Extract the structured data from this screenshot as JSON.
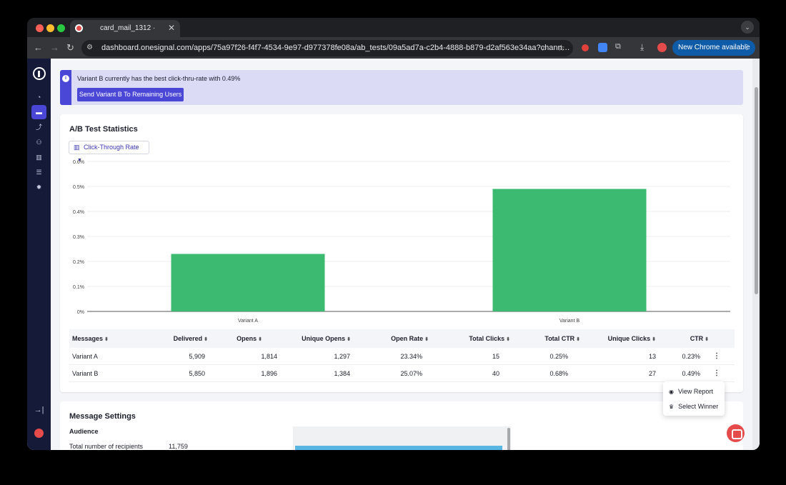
{
  "browser": {
    "tab_title": "card_mail_1312 ·",
    "tab_close": "✕",
    "url": "dashboard.onesignal.com/apps/75a97f26-f4f7-4534-9e97-d977378fe08a/ab_tests/09a5ad7a-c2b4-4888-b879-d2af563e34aa?chann…",
    "new_chrome_label": "New Chrome available",
    "colors": {
      "traffic_red": "#ff5f57",
      "traffic_yellow": "#febc2e",
      "traffic_green": "#28c840"
    }
  },
  "banner": {
    "text": "Variant B currently has the best click-thru-rate with 0.49%",
    "button_label": "Send Variant B To Remaining Users"
  },
  "stats": {
    "title": "A/B Test Statistics",
    "metric_select": "Click-Through Rate"
  },
  "chart_data": {
    "type": "bar",
    "categories": [
      "Variant A",
      "Variant B"
    ],
    "values": [
      0.23,
      0.49
    ],
    "ylim": [
      0,
      0.6
    ],
    "yticks": [
      "0%",
      "0.1%",
      "0.2%",
      "0.3%",
      "0.4%",
      "0.5%",
      "0.6%"
    ],
    "ytick_values": [
      0,
      0.1,
      0.2,
      0.3,
      0.4,
      0.5,
      0.6
    ],
    "title": "",
    "xlabel": "",
    "ylabel": "",
    "grid": true,
    "color": "#3dba72"
  },
  "table": {
    "headers": [
      "Messages",
      "Delivered",
      "Opens",
      "Unique Opens",
      "Open Rate",
      "Total Clicks",
      "Total CTR",
      "Unique Clicks",
      "CTR"
    ],
    "rows": [
      [
        "Variant A",
        "5,909",
        "1,814",
        "1,297",
        "23.34%",
        "15",
        "0.25%",
        "13",
        "0.23%"
      ],
      [
        "Variant B",
        "5,850",
        "1,896",
        "1,384",
        "25.07%",
        "40",
        "0.68%",
        "27",
        "0.49%"
      ]
    ]
  },
  "menu": {
    "view_report": "View Report",
    "select_winner": "Select Winner"
  },
  "settings": {
    "title": "Message Settings",
    "audience": "Audience",
    "recipients_label": "Total number of recipients",
    "recipients_value": "11,759"
  }
}
